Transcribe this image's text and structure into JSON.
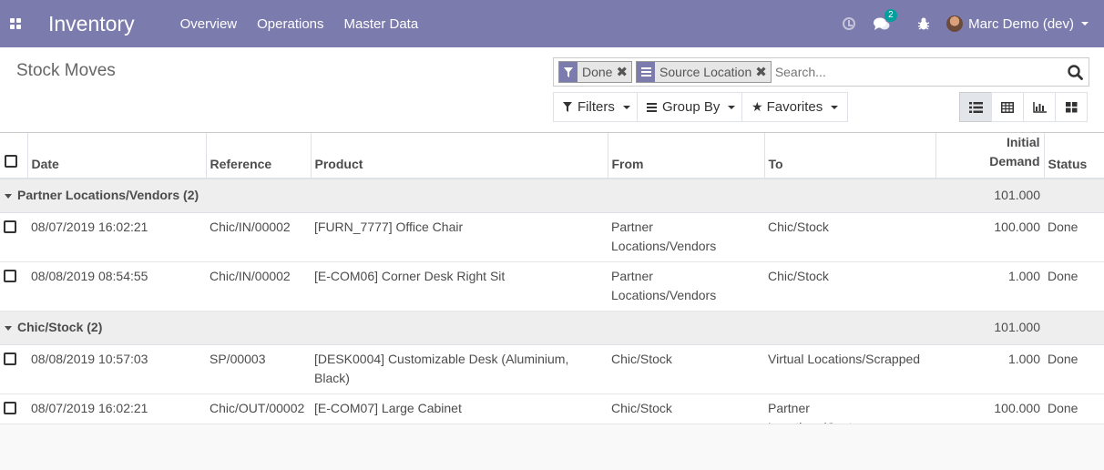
{
  "navbar": {
    "app_name": "Inventory",
    "menus": [
      "Overview",
      "Operations",
      "Master Data"
    ],
    "messages_count": "2",
    "user_name": "Marc Demo (dev)",
    "icons": [
      "apps-grid-icon",
      "clock-icon",
      "chat-icon",
      "bug-icon"
    ],
    "color": "#7c7bad"
  },
  "control": {
    "breadcrumb": "Stock Moves",
    "facets": [
      {
        "icon": "filter-icon",
        "value": "Done"
      },
      {
        "icon": "group-by-icon",
        "value": "Source Location"
      }
    ],
    "search_placeholder": "Search...",
    "filters_label": "Filters",
    "group_by_label": "Group By",
    "favorites_label": "Favorites",
    "views": [
      "list-view-icon",
      "pivot-view-icon",
      "graph-view-icon",
      "kanban-view-icon"
    ],
    "active_view": "list-view-icon"
  },
  "table": {
    "headers": {
      "date": "Date",
      "reference": "Reference",
      "product": "Product",
      "from": "From",
      "to": "To",
      "demand_line1": "Initial",
      "demand_line2": "Demand",
      "status": "Status"
    },
    "groups": [
      {
        "label": "Partner Locations/Vendors (2)",
        "total": "101.000",
        "rows": [
          {
            "date": "08/07/2019 16:02:21",
            "reference": "Chic/IN/00002",
            "product": "[FURN_7777] Office Chair",
            "from": "Partner Locations/Vendors",
            "to": "Chic/Stock",
            "demand": "100.000",
            "status": "Done"
          },
          {
            "date": "08/08/2019 08:54:55",
            "reference": "Chic/IN/00002",
            "product": "[E-COM06] Corner Desk Right Sit",
            "from": "Partner Locations/Vendors",
            "to": "Chic/Stock",
            "demand": "1.000",
            "status": "Done"
          }
        ]
      },
      {
        "label": "Chic/Stock (2)",
        "total": "101.000",
        "rows": [
          {
            "date": "08/08/2019 10:57:03",
            "reference": "SP/00003",
            "product": "[DESK0004] Customizable Desk (Aluminium, Black)",
            "from": "Chic/Stock",
            "to": "Virtual Locations/Scrapped",
            "demand": "1.000",
            "status": "Done"
          },
          {
            "date": "08/07/2019 16:02:21",
            "reference": "Chic/OUT/00002",
            "product": "[E-COM07] Large Cabinet",
            "from": "Chic/Stock",
            "to": "Partner Locations/Customers",
            "demand": "100.000",
            "status": "Done"
          }
        ]
      }
    ]
  }
}
